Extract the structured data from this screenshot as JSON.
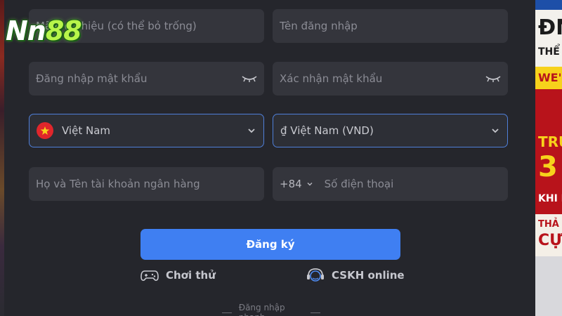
{
  "logo": {
    "part1": "Nn",
    "part2": "88"
  },
  "form": {
    "referral_code": {
      "placeholder": "Mã giới thiệu (có thể bỏ trống)"
    },
    "username": {
      "placeholder": "Tên đăng nhập"
    },
    "password": {
      "placeholder": "Đăng nhập mật khẩu"
    },
    "confirm_password": {
      "placeholder": "Xác nhận mật khẩu"
    },
    "country": {
      "value": "Việt Nam"
    },
    "currency": {
      "value": "₫ Việt Nam (VND)"
    },
    "bank_name": {
      "placeholder": "Họ và Tên tài khoản ngân hàng"
    },
    "phone": {
      "prefix": "+84",
      "placeholder": "Số điện thoại"
    }
  },
  "actions": {
    "register_label": "Đăng ký",
    "trial_label": "Chơi thử",
    "support_label": "CSKH online"
  },
  "quick_login_label": "Đăng nhập nhanh",
  "colors": {
    "primary": "#3f7ff2",
    "field_bg": "#34353c",
    "panel_bg": "#25262c",
    "selected_border": "#4f7fd9",
    "logo_green": "#b7f54a"
  },
  "icons": {
    "eye_closed": "eye-closed-icon",
    "chevron": "chevron-down-icon",
    "flag": "vietnam-flag-icon",
    "gamepad": "gamepad-icon",
    "headset": "headset-icon"
  }
}
